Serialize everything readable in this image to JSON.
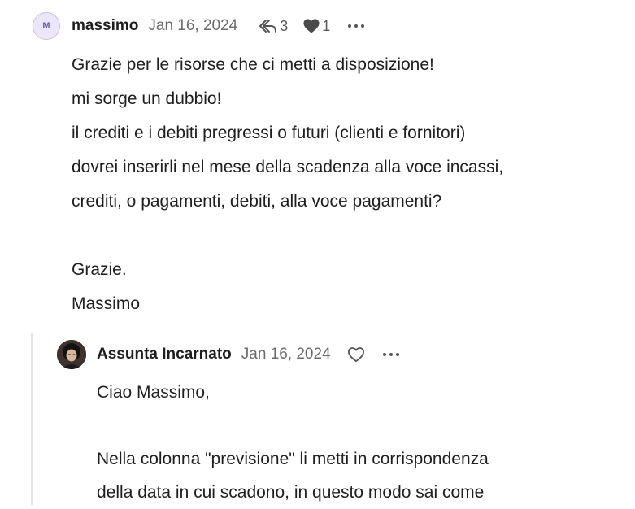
{
  "post": {
    "avatar_letter": "M",
    "username": "massimo",
    "date": "Jan 16, 2024",
    "reply_count": "3",
    "like_count": "1",
    "body": [
      "Grazie per le risorse che ci metti a disposizione!",
      "mi sorge un dubbio!",
      "il crediti e i debiti pregressi o futuri (clienti e fornitori)",
      "dovrei inserirli nel mese della scadenza alla voce incassi,",
      "crediti, o pagamenti, debiti, alla voce pagamenti?",
      "",
      "Grazie.",
      "Massimo"
    ]
  },
  "reply": {
    "username": "Assunta Incarnato",
    "date": "Jan 16, 2024",
    "body": [
      "Ciao Massimo,",
      "",
      "Nella colonna \"previsione\" li metti in corrispondenza",
      "della data in cui scadono, in questo modo sai come"
    ]
  },
  "colors": {
    "avatar_bg": "#ece7f8",
    "avatar_text": "#6a55b5",
    "text": "#1f1f1f",
    "muted": "#6b6b6b",
    "thread_line": "#e5e5e5"
  },
  "icons": {
    "reply": "reply-arrow-icon",
    "like_filled": "heart-filled-icon",
    "like_outline": "heart-outline-icon",
    "more": "more-dots-icon"
  }
}
